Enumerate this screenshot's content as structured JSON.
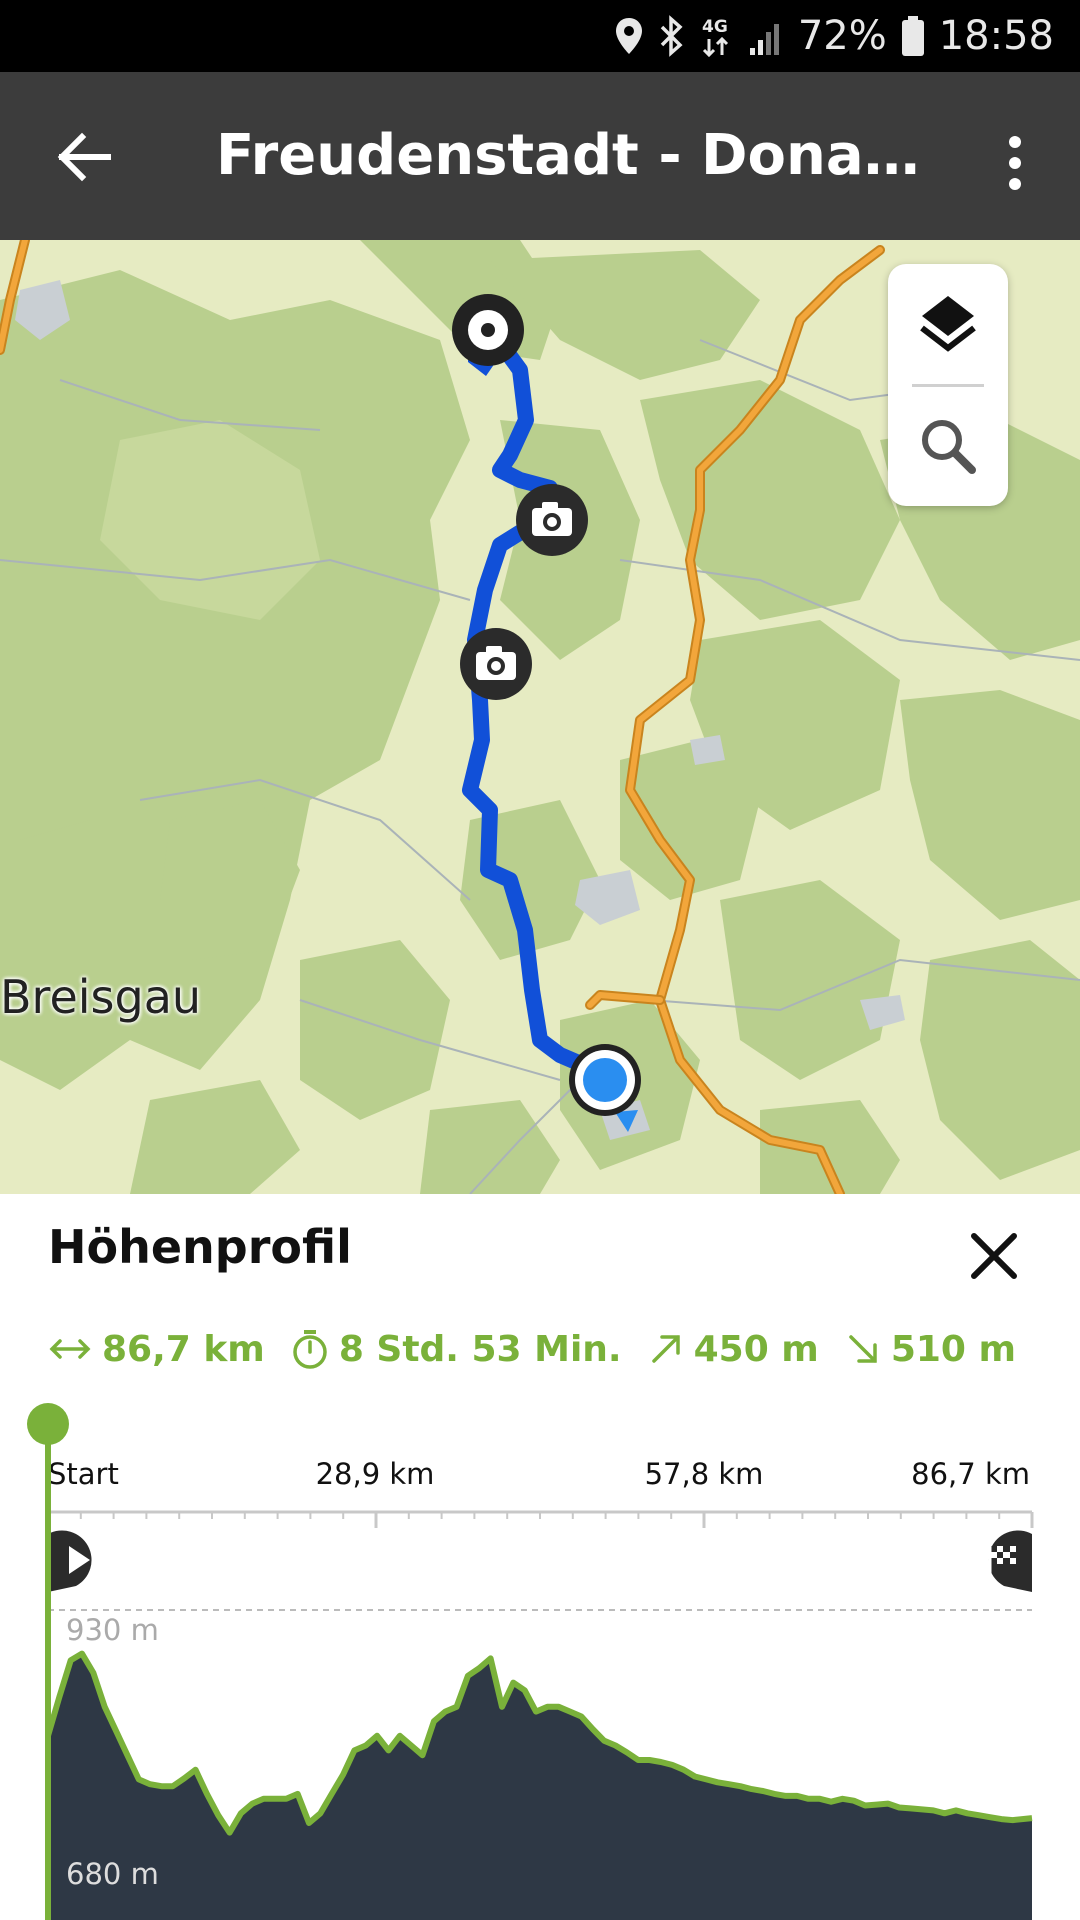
{
  "status_bar": {
    "battery": "72%",
    "time": "18:58",
    "network": "4G",
    "icons": [
      "location-icon",
      "bluetooth-icon",
      "network-4g-icon",
      "signal-icon",
      "battery-icon"
    ]
  },
  "app_bar": {
    "title": "Freudenstadt - Donauesc…",
    "back_icon": "arrow-left-icon",
    "menu_icon": "more-vert-icon"
  },
  "map": {
    "place_label": "Breisgau",
    "controls": [
      "layers-icon",
      "search-icon"
    ],
    "markers": [
      "start-marker-icon",
      "camera-icon",
      "camera-icon",
      "current-location-icon"
    ],
    "colors": {
      "route": "#1150d8",
      "road": "#f2a63b",
      "forest": "#b9cf8e",
      "open_land": "#e6ebc2",
      "location": "#2a8ef0"
    }
  },
  "elevation_panel": {
    "title": "Höhenprofil",
    "close_icon": "close-icon",
    "stats": {
      "distance": "86,7 km",
      "duration": "8 Std. 53 Min.",
      "ascent": "450 m",
      "descent": "510 m"
    },
    "axis": {
      "start": "Start",
      "tick1": "28,9 km",
      "tick2": "57,8 km",
      "end": "86,7 km"
    },
    "elevation_max_label": "930 m",
    "elevation_min_label": "680 m",
    "start_icon": "play-icon",
    "finish_icon": "finish-flag-icon",
    "accent_color": "#7ab13a",
    "fill_color": "#2e3845"
  },
  "chart_data": {
    "type": "area",
    "xlabel": "",
    "ylabel": "",
    "x_unit": "km",
    "y_unit": "m",
    "xlim": [
      0,
      86.7
    ],
    "ylim": [
      680,
      930
    ],
    "x": [
      0,
      1,
      2,
      3,
      4,
      5,
      6,
      7,
      8,
      9,
      10,
      11,
      12,
      13,
      14,
      15,
      16,
      17,
      18,
      19,
      20,
      21,
      22,
      23,
      24,
      25,
      26,
      27,
      28,
      29,
      30,
      31,
      32,
      33,
      34,
      35,
      36,
      37,
      38,
      39,
      40,
      41,
      42,
      43,
      44,
      45,
      46,
      47,
      48,
      49,
      50,
      51,
      52,
      53,
      54,
      55,
      56,
      57,
      58,
      59,
      60,
      61,
      62,
      63,
      64,
      65,
      66,
      67,
      68,
      69,
      70,
      71,
      72,
      73,
      74,
      75,
      76,
      77,
      78,
      79,
      80,
      81,
      82,
      83,
      84,
      85,
      86.7
    ],
    "y": [
      800,
      840,
      878,
      885,
      865,
      830,
      805,
      780,
      755,
      750,
      748,
      748,
      756,
      765,
      740,
      718,
      700,
      720,
      730,
      735,
      735,
      735,
      740,
      710,
      720,
      740,
      760,
      785,
      790,
      800,
      785,
      800,
      790,
      780,
      815,
      825,
      830,
      862,
      870,
      880,
      830,
      855,
      847,
      825,
      830,
      830,
      825,
      820,
      807,
      795,
      790,
      783,
      775,
      775,
      773,
      770,
      765,
      758,
      755,
      752,
      750,
      748,
      745,
      743,
      740,
      738,
      738,
      735,
      735,
      732,
      735,
      733,
      728,
      729,
      730,
      726,
      725,
      724,
      723,
      720,
      723,
      720,
      718,
      716,
      714,
      713,
      715
    ]
  }
}
